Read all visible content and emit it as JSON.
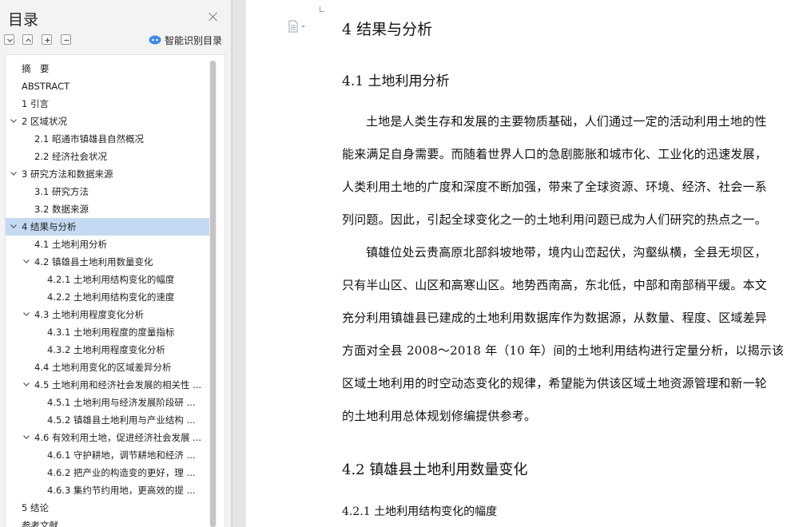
{
  "toc_panel": {
    "title": "目录",
    "smart_toc_label": "智能识别目录",
    "items": [
      {
        "label": "摘　要",
        "level": 1,
        "expanded": null
      },
      {
        "label": "ABSTRACT",
        "level": 1,
        "expanded": null
      },
      {
        "label": "1 引言",
        "level": 1,
        "expanded": null
      },
      {
        "label": "2 区域状况",
        "level": 1,
        "expanded": true
      },
      {
        "label": "2.1 昭通市镇雄县自然概况",
        "level": 2,
        "expanded": null
      },
      {
        "label": "2.2 经济社会状况",
        "level": 2,
        "expanded": null
      },
      {
        "label": "3 研究方法和数据来源",
        "level": 1,
        "expanded": true
      },
      {
        "label": "3.1 研究方法",
        "level": 2,
        "expanded": null
      },
      {
        "label": "3.2 数据来源",
        "level": 2,
        "expanded": null
      },
      {
        "label": "4 结果与分析",
        "level": 1,
        "expanded": true,
        "active": true
      },
      {
        "label": "4.1 土地利用分析",
        "level": 2,
        "expanded": null
      },
      {
        "label": "4.2 镇雄县土地利用数量变化",
        "level": 2,
        "expanded": true
      },
      {
        "label": "4.2.1 土地利用结构变化的幅度",
        "level": 3,
        "expanded": null
      },
      {
        "label": "4.2.2 土地利用结构变化的速度",
        "level": 3,
        "expanded": null
      },
      {
        "label": "4.3 土地利用程度变化分析",
        "level": 2,
        "expanded": true
      },
      {
        "label": "4.3.1 土地利用程度的度量指标",
        "level": 3,
        "expanded": null
      },
      {
        "label": "4.3.2 土地利用程度变化分析",
        "level": 3,
        "expanded": null
      },
      {
        "label": "4.4 土地利用变化的区域差异分析",
        "level": 2,
        "expanded": null
      },
      {
        "label": "4.5 土地利用和经济社会发展的相关性 ...",
        "level": 2,
        "expanded": true
      },
      {
        "label": "4.5.1 土地利用与经济发展阶段研 ...",
        "level": 3,
        "expanded": null
      },
      {
        "label": "4.5.2 镇雄县土地利用与产业结构 ...",
        "level": 3,
        "expanded": null
      },
      {
        "label": "4.6 有效利用土地，促进经济社会发展 ...",
        "level": 2,
        "expanded": true
      },
      {
        "label": "4.6.1 守护耕地，调节耕地和经济 ...",
        "level": 3,
        "expanded": null
      },
      {
        "label": "4.6.2 把产业的构造变的更好，理 ...",
        "level": 3,
        "expanded": null
      },
      {
        "label": "4.6.3 集约节约用地，更高效的提 ...",
        "level": 3,
        "expanded": null
      },
      {
        "label": "5 结论",
        "level": 1,
        "expanded": null
      },
      {
        "label": "参考文献",
        "level": 1,
        "expanded": null
      }
    ]
  },
  "document": {
    "heading_4": "4 结果与分析",
    "heading_4_1": "4.1 土地利用分析",
    "para1_lines": [
      "土地是人类生存和发展的主要物质基础，人们通过一定的活动利用土地的性",
      "能来满足自身需要。而随着世界人口的急剧膨胀和城市化、工业化的迅速发展，",
      "人类利用土地的广度和深度不断加强，带来了全球资源、环境、经济、社会一系",
      "列问题。因此，引起全球变化之一的土地利用问题已成为人们研究的热点之一。"
    ],
    "para2_lines": [
      "镇雄位处云贵高原北部斜坡地带，境内山峦起伏，沟壑纵横，全县无坝区，",
      "只有半山区、山区和高寒山区。地势西南高，东北低，中部和南部稍平缓。本文",
      "充分利用镇雄县已建成的土地利用数据库作为数据源，从数量、程度、区域差异",
      "方面对全县 2008～2018 年（10 年）间的土地利用结构进行定量分析，以揭示该",
      "区域土地利用的时空动态变化的规律，希望能为供该区域土地资源管理和新一轮",
      "的土地利用总体规划修编提供参考。"
    ],
    "heading_4_2": "4.2 镇雄县土地利用数量变化",
    "heading_4_2_1": "4.2.1 土地利用结构变化的幅度"
  },
  "colors": {
    "active_item": "#c5daf2",
    "smart_icon": "#3d8be8"
  }
}
